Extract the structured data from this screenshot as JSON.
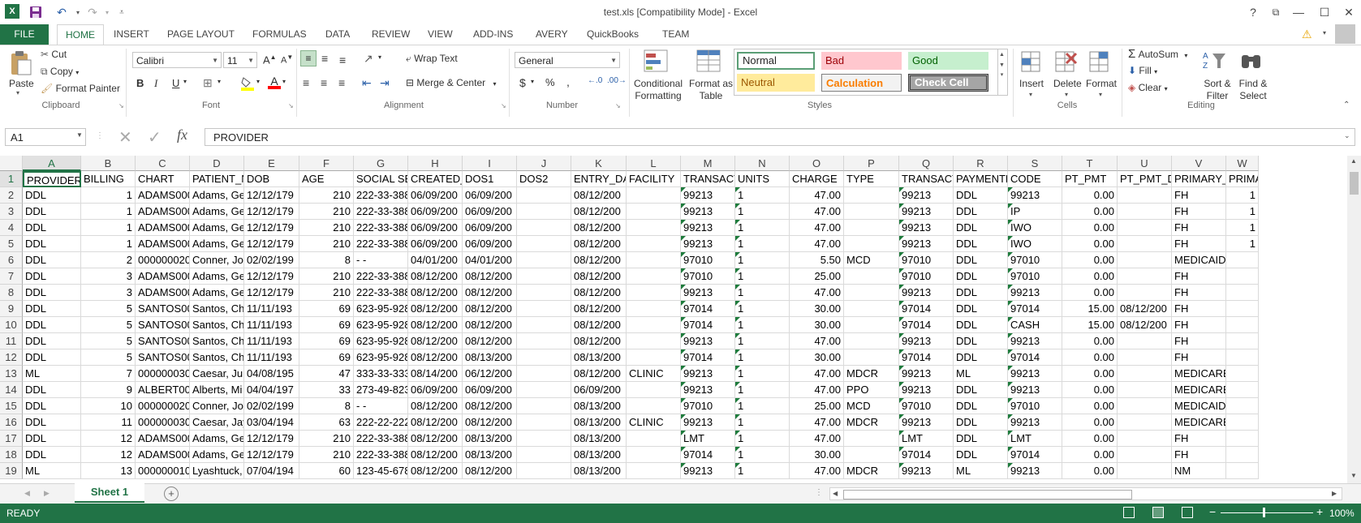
{
  "window": {
    "title": "test.xls  [Compatibility Mode] - Excel",
    "buttons": {
      "help": "?",
      "restore_ribbon": "⧉",
      "minimize": "—",
      "maximize": "☐",
      "close": "✕"
    }
  },
  "tabs": [
    "FILE",
    "HOME",
    "INSERT",
    "PAGE LAYOUT",
    "FORMULAS",
    "DATA",
    "REVIEW",
    "VIEW",
    "ADD-INS",
    "AVERY",
    "QuickBooks",
    "TEAM"
  ],
  "ribbon": {
    "clipboard": {
      "paste": "Paste",
      "cut": "Cut",
      "copy": "Copy",
      "format_painter": "Format Painter",
      "label": "Clipboard"
    },
    "font": {
      "name": "Calibri",
      "size": "11",
      "label": "Font"
    },
    "alignment": {
      "wrap": "Wrap Text",
      "merge": "Merge & Center",
      "label": "Alignment"
    },
    "number": {
      "format": "General",
      "label": "Number"
    },
    "styles": {
      "conditional": "Conditional Formatting",
      "format_as_table": "Format as Table",
      "cells": [
        "Normal",
        "Bad",
        "Good",
        "Neutral",
        "Calculation",
        "Check Cell"
      ],
      "label": "Styles"
    },
    "cells_group": {
      "insert": "Insert",
      "delete": "Delete",
      "format": "Format",
      "label": "Cells"
    },
    "editing": {
      "autosum": "AutoSum",
      "fill": "Fill",
      "clear": "Clear",
      "sort_filter": "Sort & Filter",
      "find_select": "Find & Select",
      "label": "Editing"
    }
  },
  "formula_bar": {
    "name_box": "A1",
    "formula": "PROVIDER"
  },
  "grid": {
    "columns": [
      "A",
      "B",
      "C",
      "D",
      "E",
      "F",
      "G",
      "H",
      "I",
      "J",
      "K",
      "L",
      "M",
      "N",
      "O",
      "P",
      "Q",
      "R",
      "S",
      "T",
      "U",
      "V",
      "W"
    ],
    "rows": [
      [
        "PROVIDER",
        "BILLING",
        "CHART",
        "PATIENT_N",
        "DOB",
        "AGE",
        "SOCIAL SEC",
        "CREATED_D",
        "DOS1",
        "DOS2",
        "ENTRY_DAT",
        "FACILITY",
        "TRANSACTI",
        "UNITS",
        "CHARGE",
        "TYPE",
        "TRANSACTI",
        "PAYMENTP",
        "CODE",
        "PT_PMT",
        "PT_PMT_DA",
        "PRIMARY_I",
        "PRIMA"
      ],
      [
        "DDL",
        "1",
        "ADAMS000",
        "Adams, Ge",
        "12/12/179",
        "210",
        "222-33-388",
        "06/09/200",
        "06/09/200",
        "",
        "08/12/200",
        "",
        "99213",
        "1",
        "47.00",
        "",
        "99213",
        "DDL",
        "99213",
        "0.00",
        "",
        "FH",
        "1"
      ],
      [
        "DDL",
        "1",
        "ADAMS000",
        "Adams, Ge",
        "12/12/179",
        "210",
        "222-33-388",
        "06/09/200",
        "06/09/200",
        "",
        "08/12/200",
        "",
        "99213",
        "1",
        "47.00",
        "",
        "99213",
        "DDL",
        "IP",
        "0.00",
        "",
        "FH",
        "1"
      ],
      [
        "DDL",
        "1",
        "ADAMS000",
        "Adams, Ge",
        "12/12/179",
        "210",
        "222-33-388",
        "06/09/200",
        "06/09/200",
        "",
        "08/12/200",
        "",
        "99213",
        "1",
        "47.00",
        "",
        "99213",
        "DDL",
        "IWO",
        "0.00",
        "",
        "FH",
        "1"
      ],
      [
        "DDL",
        "1",
        "ADAMS000",
        "Adams, Ge",
        "12/12/179",
        "210",
        "222-33-388",
        "06/09/200",
        "06/09/200",
        "",
        "08/12/200",
        "",
        "99213",
        "1",
        "47.00",
        "",
        "99213",
        "DDL",
        "IWO",
        "0.00",
        "",
        "FH",
        "1"
      ],
      [
        "DDL",
        "2",
        "000000020",
        "Conner, Jor",
        "02/02/199",
        "8",
        "- -",
        "04/01/200",
        "04/01/200",
        "",
        "08/12/200",
        "",
        "97010",
        "1",
        "5.50",
        "MCD",
        "97010",
        "DDL",
        "97010",
        "0.00",
        "",
        "MEDICAID",
        ""
      ],
      [
        "DDL",
        "3",
        "ADAMS000",
        "Adams, Ge",
        "12/12/179",
        "210",
        "222-33-388",
        "08/12/200",
        "08/12/200",
        "",
        "08/12/200",
        "",
        "97010",
        "1",
        "25.00",
        "",
        "97010",
        "DDL",
        "97010",
        "0.00",
        "",
        "FH",
        ""
      ],
      [
        "DDL",
        "3",
        "ADAMS000",
        "Adams, Ge",
        "12/12/179",
        "210",
        "222-33-388",
        "08/12/200",
        "08/12/200",
        "",
        "08/12/200",
        "",
        "99213",
        "1",
        "47.00",
        "",
        "99213",
        "DDL",
        "99213",
        "0.00",
        "",
        "FH",
        ""
      ],
      [
        "DDL",
        "5",
        "SANTOS00",
        "Santos, Cha",
        "11/11/193",
        "69",
        "623-95-928",
        "08/12/200",
        "08/12/200",
        "",
        "08/12/200",
        "",
        "97014",
        "1",
        "30.00",
        "",
        "97014",
        "DDL",
        "97014",
        "15.00",
        "08/12/200",
        "FH",
        ""
      ],
      [
        "DDL",
        "5",
        "SANTOS00",
        "Santos, Cha",
        "11/11/193",
        "69",
        "623-95-928",
        "08/12/200",
        "08/12/200",
        "",
        "08/12/200",
        "",
        "97014",
        "1",
        "30.00",
        "",
        "97014",
        "DDL",
        "CASH",
        "15.00",
        "08/12/200",
        "FH",
        ""
      ],
      [
        "DDL",
        "5",
        "SANTOS00",
        "Santos, Cha",
        "11/11/193",
        "69",
        "623-95-928",
        "08/12/200",
        "08/12/200",
        "",
        "08/12/200",
        "",
        "99213",
        "1",
        "47.00",
        "",
        "99213",
        "DDL",
        "99213",
        "0.00",
        "",
        "FH",
        ""
      ],
      [
        "DDL",
        "5",
        "SANTOS00",
        "Santos, Cha",
        "11/11/193",
        "69",
        "623-95-928",
        "08/12/200",
        "08/13/200",
        "",
        "08/13/200",
        "",
        "97014",
        "1",
        "30.00",
        "",
        "97014",
        "DDL",
        "97014",
        "0.00",
        "",
        "FH",
        ""
      ],
      [
        "ML",
        "7",
        "000000030",
        "Caesar, Juli",
        "04/08/195",
        "47",
        "333-33-333",
        "08/14/200",
        "06/12/200",
        "",
        "08/12/200",
        "CLINIC",
        "99213",
        "1",
        "47.00",
        "MDCR",
        "99213",
        "ML",
        "99213",
        "0.00",
        "",
        "MEDICARE",
        ""
      ],
      [
        "DDL",
        "9",
        "ALBERT000",
        "Alberts, Mi",
        "04/04/197",
        "33",
        "273-49-823",
        "06/09/200",
        "06/09/200",
        "",
        "06/09/200",
        "",
        "99213",
        "1",
        "47.00",
        "PPO",
        "99213",
        "DDL",
        "99213",
        "0.00",
        "",
        "MEDICARE",
        ""
      ],
      [
        "DDL",
        "10",
        "000000020",
        "Conner, Jor",
        "02/02/199",
        "8",
        "- -",
        "08/12/200",
        "08/12/200",
        "",
        "08/13/200",
        "",
        "97010",
        "1",
        "25.00",
        "MCD",
        "97010",
        "DDL",
        "97010",
        "0.00",
        "",
        "MEDICAID",
        ""
      ],
      [
        "DDL",
        "11",
        "000000030",
        "Caesar, Jay",
        "03/04/194",
        "63",
        "222-22-222",
        "08/12/200",
        "08/12/200",
        "",
        "08/13/200",
        "CLINIC",
        "99213",
        "1",
        "47.00",
        "MDCR",
        "99213",
        "DDL",
        "99213",
        "0.00",
        "",
        "MEDICARE",
        ""
      ],
      [
        "DDL",
        "12",
        "ADAMS000",
        "Adams, Ge",
        "12/12/179",
        "210",
        "222-33-388",
        "08/12/200",
        "08/13/200",
        "",
        "08/13/200",
        "",
        "LMT",
        "1",
        "47.00",
        "",
        "LMT",
        "DDL",
        "LMT",
        "0.00",
        "",
        "FH",
        ""
      ],
      [
        "DDL",
        "12",
        "ADAMS000",
        "Adams, Ge",
        "12/12/179",
        "210",
        "222-33-388",
        "08/12/200",
        "08/13/200",
        "",
        "08/13/200",
        "",
        "97014",
        "1",
        "30.00",
        "",
        "97014",
        "DDL",
        "97014",
        "0.00",
        "",
        "FH",
        ""
      ],
      [
        "ML",
        "13",
        "000000010",
        "Lyashtuck, :",
        "07/04/194",
        "60",
        "123-45-678",
        "08/12/200",
        "08/12/200",
        "",
        "08/13/200",
        "",
        "99213",
        "1",
        "47.00",
        "MDCR",
        "99213",
        "ML",
        "99213",
        "0.00",
        "",
        "NM",
        ""
      ]
    ]
  },
  "sheet_tabs": [
    "Sheet 1"
  ],
  "status": {
    "text": "READY",
    "zoom": "100%"
  },
  "colors": {
    "excel_green": "#217346",
    "normal": "#ffffff",
    "bad": "#ffc7ce",
    "good": "#c6efce",
    "neutral": "#ffeb9c",
    "calculation": "#f2f2f2",
    "check_cell": "#a5a5a5"
  }
}
